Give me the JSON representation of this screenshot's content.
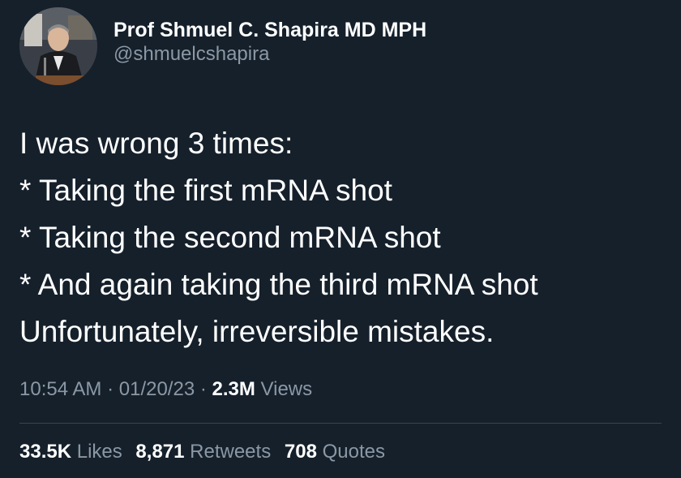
{
  "author": {
    "display_name": "Prof Shmuel C. Shapira MD MPH",
    "handle": "@shmuelcshapira"
  },
  "tweet": {
    "lines": [
      "I was wrong 3 times:",
      "* Taking the first mRNA shot",
      "* Taking the second mRNA shot",
      "* And again taking the third mRNA shot",
      "Unfortunately, irreversible mistakes."
    ]
  },
  "meta": {
    "time": "10:54 AM",
    "separator": "·",
    "date": "01/20/23",
    "views_count": "2.3M",
    "views_label": "Views"
  },
  "stats": {
    "likes_count": "33.5K",
    "likes_label": "Likes",
    "retweets_count": "8,871",
    "retweets_label": "Retweets",
    "quotes_count": "708",
    "quotes_label": "Quotes"
  },
  "colors": {
    "background": "#15202b",
    "primary_text": "#ffffff",
    "secondary_text": "#8b98a5",
    "divider": "#38444d"
  }
}
